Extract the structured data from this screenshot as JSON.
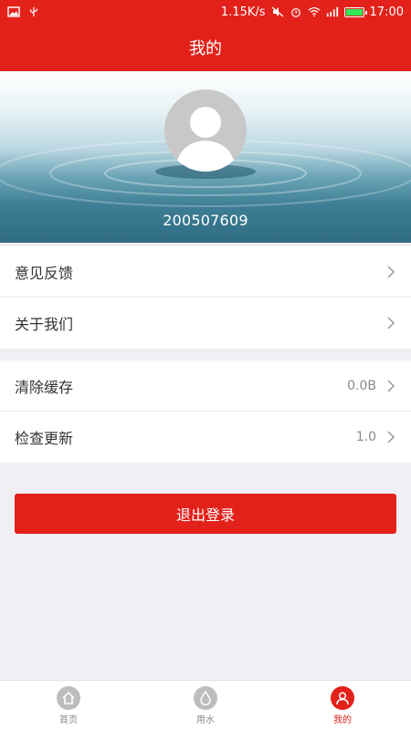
{
  "status_bar": {
    "speed": "1.15K/s",
    "time": "17:00"
  },
  "header": {
    "title": "我的"
  },
  "profile": {
    "username": "200507609"
  },
  "menu_group_1": [
    {
      "label": "意见反馈"
    },
    {
      "label": "关于我们"
    }
  ],
  "menu_group_2": [
    {
      "label": "清除缓存",
      "value": "0.0B"
    },
    {
      "label": "检查更新",
      "value": "1.0"
    }
  ],
  "logout": {
    "label": "退出登录"
  },
  "tabbar": {
    "items": [
      {
        "label": "首页",
        "icon": "home-icon",
        "active": false
      },
      {
        "label": "用水",
        "icon": "water-drop-icon",
        "active": false
      },
      {
        "label": "我的",
        "icon": "user-icon",
        "active": true
      }
    ]
  },
  "colors": {
    "brand": "#e3211b",
    "background": "#efeff4"
  }
}
